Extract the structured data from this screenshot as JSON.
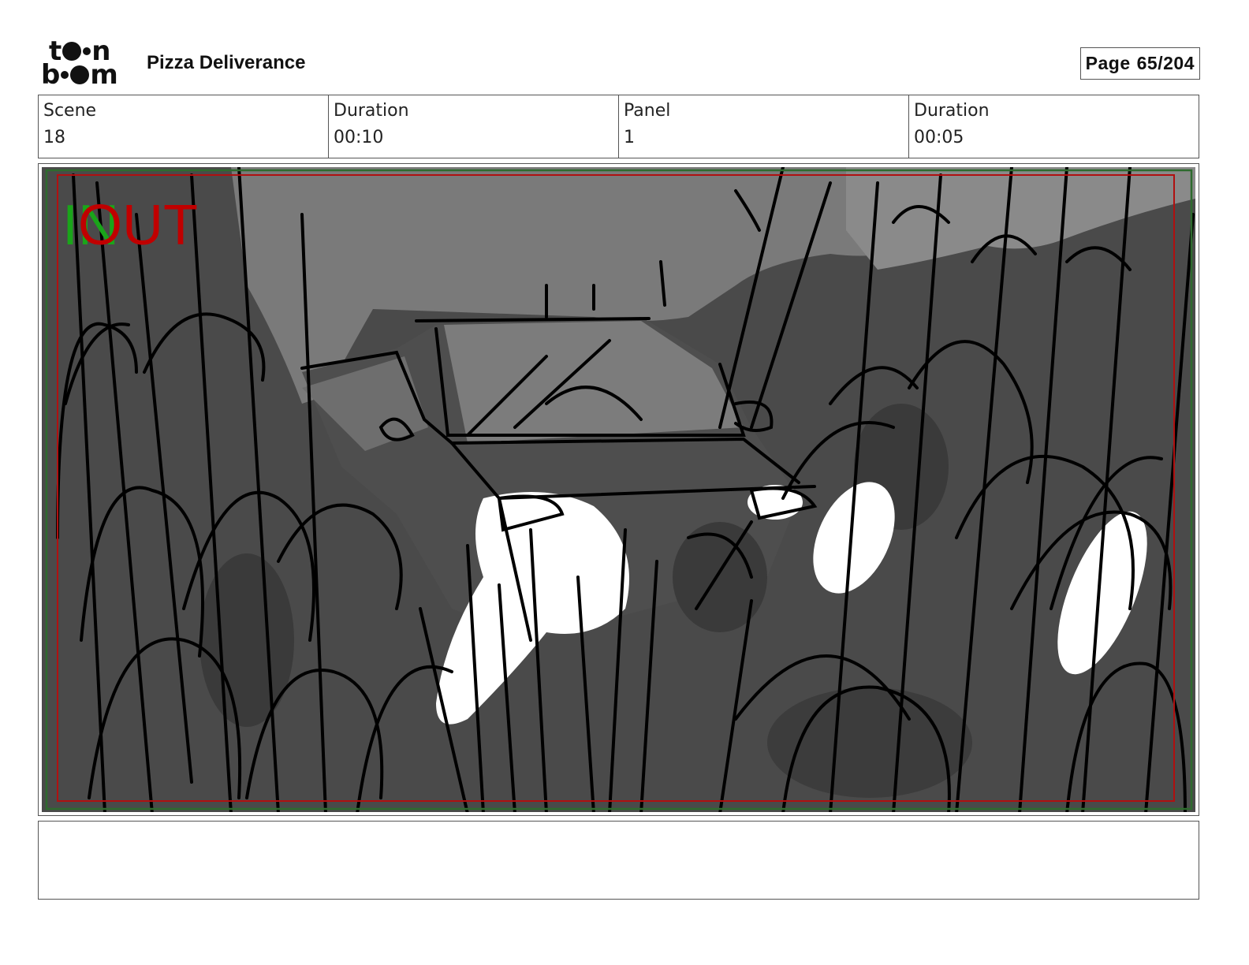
{
  "header": {
    "logo_text": "toon boom",
    "project_title": "Pizza Deliverance",
    "page_label": "Page",
    "page_number": "65/204"
  },
  "info": {
    "scene_label": "Scene",
    "scene_value": "18",
    "scene_duration_label": "Duration",
    "scene_duration_value": "00:10",
    "panel_label": "Panel",
    "panel_value": "1",
    "panel_duration_label": "Duration",
    "panel_duration_value": "00:05"
  },
  "panel": {
    "in_label": "IN",
    "out_label": "OUT",
    "colors": {
      "in": "#1aa51a",
      "out": "#c00000",
      "safe_frame": "#2e6b2e",
      "title_safe": "#b01010"
    }
  },
  "caption": {
    "text": ""
  }
}
